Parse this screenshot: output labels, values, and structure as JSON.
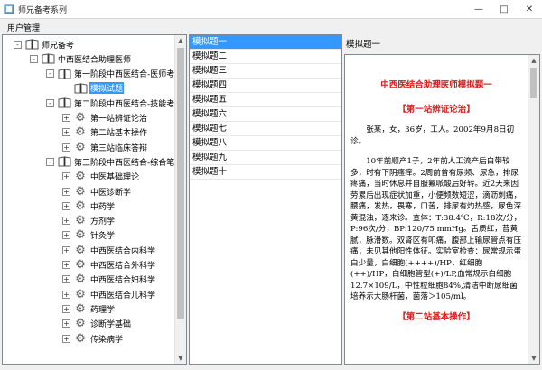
{
  "window": {
    "title": "师兄备考系列",
    "controls": [
      "minimize-icon",
      "maximize-icon",
      "close-icon"
    ]
  },
  "menu": {
    "items": [
      "用户管理"
    ]
  },
  "tree": {
    "rows": [
      {
        "level": 0,
        "exp": "-",
        "icon": "book",
        "label": "师兄备考"
      },
      {
        "level": 1,
        "exp": "-",
        "icon": "book",
        "label": "中西医结合助理医师"
      },
      {
        "level": 2,
        "exp": "-",
        "icon": "book",
        "label": "第一阶段中西医结合-医师考试"
      },
      {
        "level": 3,
        "exp": "",
        "icon": "book",
        "label": "模拟试题",
        "selected": true
      },
      {
        "level": 2,
        "exp": "-",
        "icon": "book",
        "label": "第二阶段中西医结合-技能考试"
      },
      {
        "level": 3,
        "exp": "+",
        "icon": "gear",
        "label": "第一站辨证论治"
      },
      {
        "level": 3,
        "exp": "+",
        "icon": "gear",
        "label": "第二站基本操作"
      },
      {
        "level": 3,
        "exp": "+",
        "icon": "gear",
        "label": "第三站临床答辩"
      },
      {
        "level": 2,
        "exp": "-",
        "icon": "book",
        "label": "第三阶段中西医结合-综合笔试"
      },
      {
        "level": 3,
        "exp": "+",
        "icon": "gear",
        "label": "中医基础理论"
      },
      {
        "level": 3,
        "exp": "+",
        "icon": "gear",
        "label": "中医诊断学"
      },
      {
        "level": 3,
        "exp": "+",
        "icon": "gear",
        "label": "中药学"
      },
      {
        "level": 3,
        "exp": "+",
        "icon": "gear",
        "label": "方剂学"
      },
      {
        "level": 3,
        "exp": "+",
        "icon": "gear",
        "label": "针灸学"
      },
      {
        "level": 3,
        "exp": "+",
        "icon": "gear",
        "label": "中西医结合内科学"
      },
      {
        "level": 3,
        "exp": "+",
        "icon": "gear",
        "label": "中西医结合外科学"
      },
      {
        "level": 3,
        "exp": "+",
        "icon": "gear",
        "label": "中西医结合妇科学"
      },
      {
        "level": 3,
        "exp": "+",
        "icon": "gear",
        "label": "中西医结合儿科学"
      },
      {
        "level": 3,
        "exp": "+",
        "icon": "gear",
        "label": "药理学"
      },
      {
        "level": 3,
        "exp": "+",
        "icon": "gear",
        "label": "诊断学基础"
      },
      {
        "level": 3,
        "exp": "+",
        "icon": "gear",
        "label": "传染病学"
      }
    ]
  },
  "list": {
    "items": [
      "模拟题一",
      "模拟题二",
      "模拟题三",
      "模拟题四",
      "模拟题五",
      "模拟题六",
      "模拟题七",
      "模拟题八",
      "模拟题九",
      "模拟题十"
    ],
    "selected_index": 0
  },
  "detail": {
    "title": "模拟题一",
    "doc_title": "中西医结合助理医师模拟题一",
    "section1": "【第一站辨证论治】",
    "para1": "张某，女，36岁，工人。2002年9月8日初诊。",
    "para2": "10年前顺产1子，2年前人工流产后白带较多，时有下阴瘙痒。2周前曾有尿频、尿急，排尿疼痛，当时休息并自服氟哌酸后好转。近2天来因劳累后出现症状加重，小便频数短涩，滴沥刺痛，腰痛，发热，畏寒，口苦，排尿有灼热感，尿色深黄混浊，逐来诊。查体：T:38.4℃，R:18次/分，P:96次/分，BP:120/75 mmHg。舌质红，苔黄腻，脉滑数。双肾区有叩痛，腹部上输尿管点有压痛，未见其他阳性体征。实验室检查：尿常规示蛋白少量，白细胞(++++)/HP，红细胞(++)/HP，白细胞管型(+)/LP,血常规示白细胞12.7×109/L，中性粒细胞84%,清洁中断尿细菌培养示大肠杆菌，菌落＞105/ml。",
    "section2": "【第二站基本操作】"
  },
  "colors": {
    "selection": "#3399ff",
    "heading_red": "#d41f1f"
  }
}
